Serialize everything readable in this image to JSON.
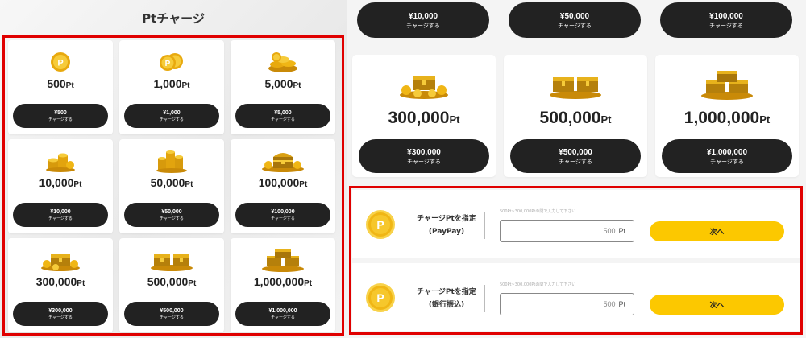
{
  "page": {
    "title": "Ptチャージ"
  },
  "unit": "Pt",
  "charge_label": "チャージする",
  "left_cards": [
    {
      "amount": "500",
      "price": "¥500",
      "icon": "coin-single-icon"
    },
    {
      "amount": "1,000",
      "price": "¥1,000",
      "icon": "coins-two-icon"
    },
    {
      "amount": "5,000",
      "price": "¥5,000",
      "icon": "coins-pile-small-icon"
    },
    {
      "amount": "10,000",
      "price": "¥10,000",
      "icon": "coins-stack-icon"
    },
    {
      "amount": "50,000",
      "price": "¥50,000",
      "icon": "coins-stacks-icon"
    },
    {
      "amount": "100,000",
      "price": "¥100,000",
      "icon": "treasure-chest-icon"
    },
    {
      "amount": "300,000",
      "price": "¥300,000",
      "icon": "treasure-chest-coins-icon"
    },
    {
      "amount": "500,000",
      "price": "¥500,000",
      "icon": "treasure-chests-two-icon"
    },
    {
      "amount": "1,000,000",
      "price": "¥1,000,000",
      "icon": "treasure-chests-pile-icon"
    }
  ],
  "right_top_buttons": [
    {
      "price": "¥10,000"
    },
    {
      "price": "¥50,000"
    },
    {
      "price": "¥100,000"
    }
  ],
  "right_cards": [
    {
      "amount": "300,000",
      "price": "¥300,000",
      "icon": "treasure-chest-coins-icon"
    },
    {
      "amount": "500,000",
      "price": "¥500,000",
      "icon": "treasure-chests-two-icon"
    },
    {
      "amount": "1,000,000",
      "price": "¥1,000,000",
      "icon": "treasure-chests-pile-icon"
    }
  ],
  "custom_charge": [
    {
      "label": "チャージPtを指定",
      "method": "(PayPay)",
      "hint": "500Pt~300,000Ptの間で入力して下さい",
      "value": "500",
      "unit": "Pt",
      "button": "次へ",
      "icon_letter": "P"
    },
    {
      "label": "チャージPtを指定",
      "method": "(銀行振込)",
      "hint": "500Pt~300,000Ptの間で入力して下さい",
      "value": "500",
      "unit": "Pt",
      "button": "次へ",
      "icon_letter": "P"
    }
  ],
  "colors": {
    "highlight": "#e00000",
    "button_dark": "#222222",
    "button_yellow": "#fcc800",
    "coin_gold": "#f0b615"
  }
}
